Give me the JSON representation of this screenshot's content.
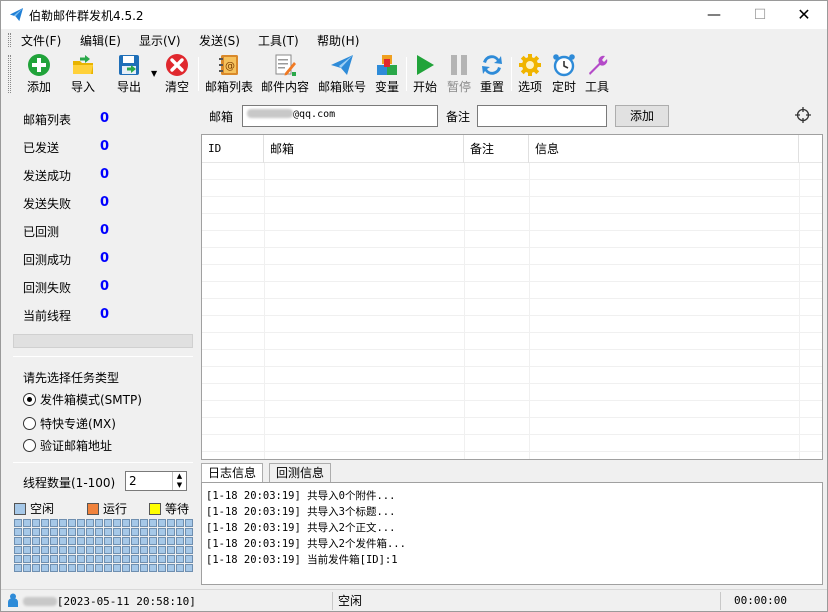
{
  "window": {
    "title": "伯勒邮件群发机4.5.2"
  },
  "menu": [
    "文件(F)",
    "编辑(E)",
    "显示(V)",
    "发送(S)",
    "工具(T)",
    "帮助(H)"
  ],
  "toolbar": {
    "add": "添加",
    "import": "导入",
    "export": "导出",
    "clear": "清空",
    "mailbox_list": "邮箱列表",
    "mail_content": "邮件内容",
    "mail_account": "邮箱账号",
    "variables": "变量",
    "start": "开始",
    "pause": "暂停",
    "reset": "重置",
    "options": "选项",
    "timer": "定时",
    "tools": "工具"
  },
  "stats": [
    {
      "label": "邮箱列表",
      "value": "0"
    },
    {
      "label": "已发送",
      "value": "0"
    },
    {
      "label": "发送成功",
      "value": "0"
    },
    {
      "label": "发送失败",
      "value": "0"
    },
    {
      "label": "已回测",
      "value": "0"
    },
    {
      "label": "回测成功",
      "value": "0"
    },
    {
      "label": "回测失败",
      "value": "0"
    },
    {
      "label": "当前线程",
      "value": "0"
    }
  ],
  "progress": 0,
  "task": {
    "title": "请先选择任务类型",
    "options": [
      {
        "label": "发件箱模式(SMTP)",
        "checked": true
      },
      {
        "label": "特快专递(MX)",
        "checked": false
      },
      {
        "label": "验证邮箱地址",
        "checked": false
      }
    ]
  },
  "threads": {
    "label": "线程数量(1-100)",
    "value": "2",
    "cell_count": 120
  },
  "legend": [
    {
      "label": "空闲",
      "color": "#a6c8e8"
    },
    {
      "label": "运行",
      "color": "#f0823c"
    },
    {
      "label": "等待",
      "color": "#ffff00"
    }
  ],
  "form": {
    "email_label": "邮箱",
    "email_value": "@qq.com",
    "note_label": "备注",
    "note_value": "",
    "add_button": "添加"
  },
  "grid": {
    "columns": [
      "ID",
      "邮箱",
      "备注",
      "信息"
    ]
  },
  "tabs": [
    "日志信息",
    "回测信息"
  ],
  "log": [
    "[1-18 20:03:19] 共导入0个附件...",
    "[1-18 20:03:19] 共导入3个标题...",
    "[1-18 20:03:19] 共导入2个正文...",
    "[1-18 20:03:19] 共导入2个发件箱...",
    "[1-18 20:03:19] 当前发件箱[ID]:1"
  ],
  "status": {
    "expiry": "[2023-05-11 20:58:10]",
    "state": "空闲",
    "elapsed": "00:00:00"
  }
}
